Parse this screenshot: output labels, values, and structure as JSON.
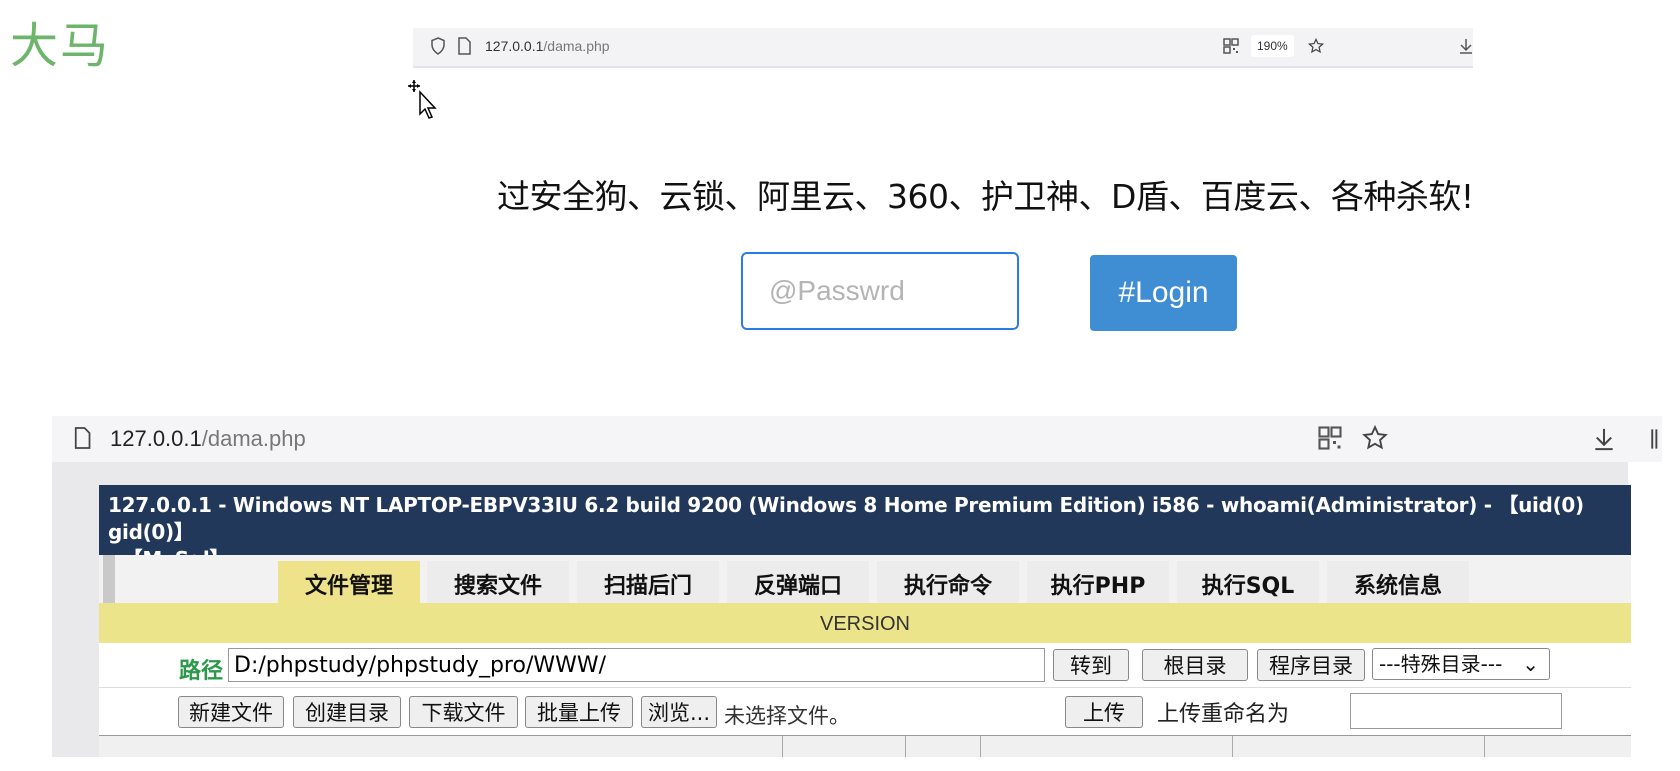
{
  "slide": {
    "title": "大马"
  },
  "top_browser": {
    "url_host": "127.0.0.1",
    "url_path": "/dama.php",
    "zoom": "190%"
  },
  "login_page": {
    "headline": "过安全狗、云锁、阿里云、360、护卫神、D盾、百度云、各种杀软!",
    "password_placeholder": "@Passwrd",
    "login_label": "#Login",
    "accent_color": "#3f8dd3"
  },
  "second_browser": {
    "url_host": "127.0.0.1",
    "url_path": "/dama.php"
  },
  "shell": {
    "header_line1": "127.0.0.1 - Windows NT LAPTOP-EBPV33IU 6.2 build 9200 (Windows 8 Home Premium Edition) i586 - whoami(Administrator) - 【uid(0) gid(0)】",
    "header_line2": "- 【MySql】",
    "tabs": [
      "文件管理",
      "搜索文件",
      "扫描后门",
      "反弹端口",
      "执行命令",
      "执行PHP",
      "执行SQL",
      "系统信息"
    ],
    "active_tab": "文件管理",
    "version": "VERSION",
    "path_label": "路径",
    "path_value": "D:/phpstudy/phpstudy_pro/WWW/",
    "goto_label": "转到",
    "root_label": "根目录",
    "program_dir_label": "程序目录",
    "special_dir_selected": "---特殊目录---",
    "new_file_label": "新建文件",
    "create_dir_label": "创建目录",
    "download_file_label": "下载文件",
    "batch_upload_label": "批量上传",
    "browse_label": "浏览...",
    "no_file_text": "未选择文件。",
    "upload_label": "上传",
    "rename_label": "上传重命名为",
    "header_color": "#22385a",
    "highlight_color": "#ece48a"
  }
}
